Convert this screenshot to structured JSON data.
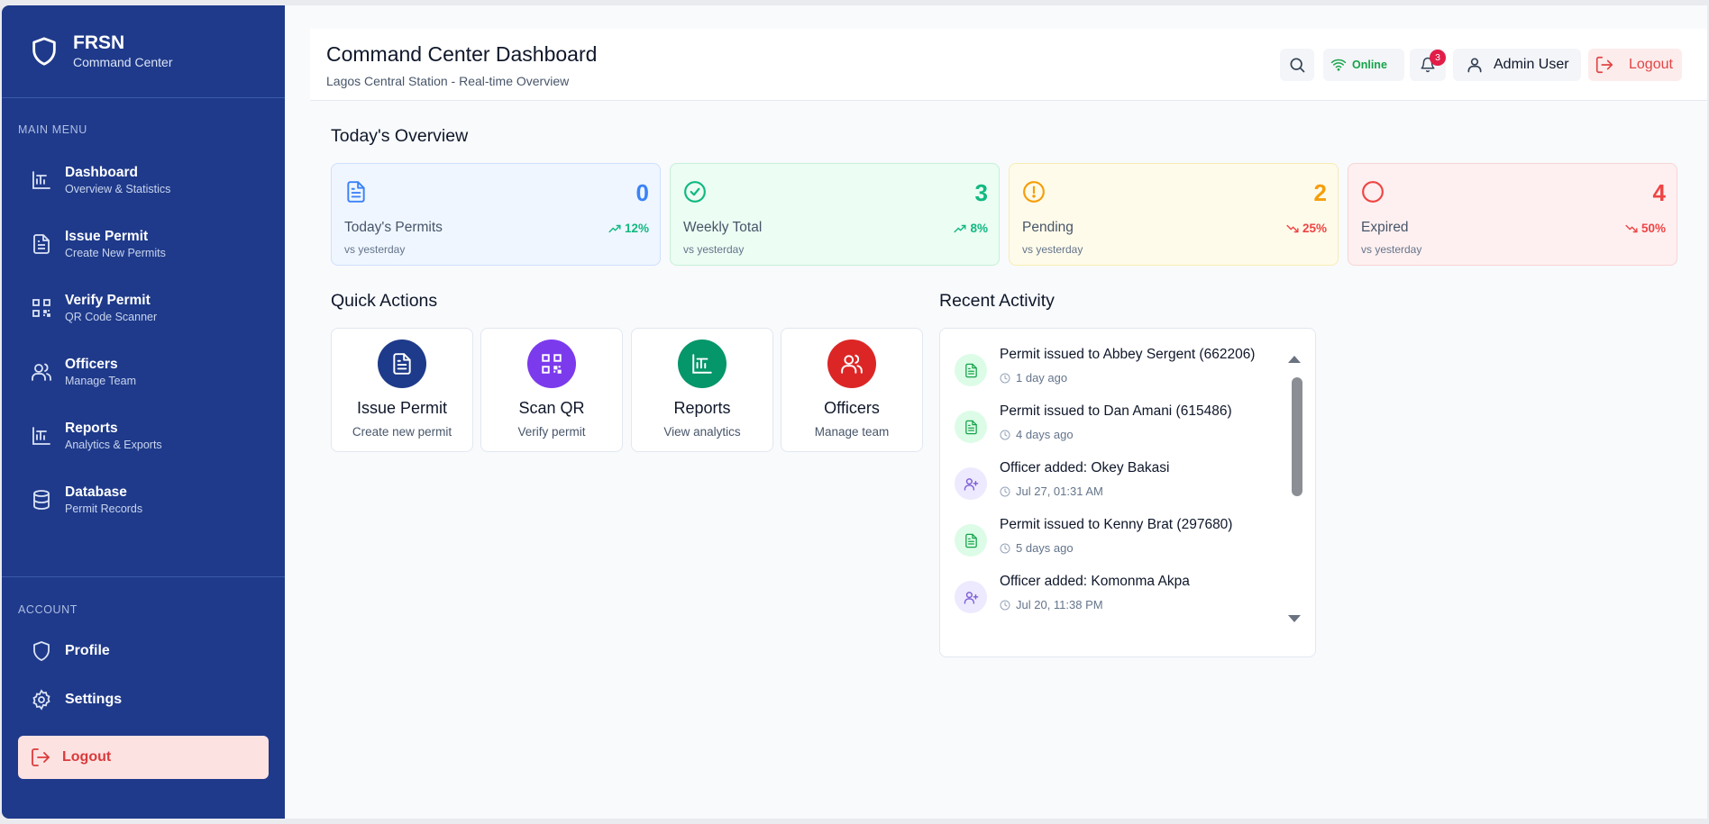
{
  "brand": {
    "name": "FRSN",
    "subtitle": "Command Center",
    "icon": "shield-icon"
  },
  "sidebar": {
    "main_menu_label": "MAIN MENU",
    "items": [
      {
        "title": "Dashboard",
        "subtitle": "Overview & Statistics",
        "icon": "bar-chart-icon"
      },
      {
        "title": "Issue Permit",
        "subtitle": "Create New Permits",
        "icon": "file-text-icon"
      },
      {
        "title": "Verify Permit",
        "subtitle": "QR Code Scanner",
        "icon": "qr-code-icon"
      },
      {
        "title": "Officers",
        "subtitle": "Manage Team",
        "icon": "users-icon"
      },
      {
        "title": "Reports",
        "subtitle": "Analytics & Exports",
        "icon": "bar-chart-icon"
      },
      {
        "title": "Database",
        "subtitle": "Permit Records",
        "icon": "database-icon"
      }
    ],
    "account_label": "ACCOUNT",
    "account_items": [
      {
        "title": "Profile",
        "icon": "shield-icon"
      },
      {
        "title": "Settings",
        "icon": "gear-icon"
      }
    ],
    "logout_label": "Logout"
  },
  "header": {
    "title": "Command Center Dashboard",
    "subtitle": "Lagos Central Station - Real-time Overview",
    "status": "Online",
    "notification_count": "3",
    "user_name": "Admin User",
    "logout_label": "Logout"
  },
  "overview": {
    "title": "Today's Overview",
    "cards": [
      {
        "label": "Today's Permits",
        "value": "0",
        "trend": "12%",
        "trend_dir": "up",
        "foot": "vs yesterday",
        "icon": "file-text-icon",
        "color": "#3b82f6",
        "bg": "#eff6ff",
        "border": "#cfe0fb",
        "trend_color": "#10b981"
      },
      {
        "label": "Weekly Total",
        "value": "3",
        "trend": "8%",
        "trend_dir": "up",
        "foot": "vs yesterday",
        "icon": "check-circle-icon",
        "color": "#10b981",
        "bg": "#ecfdf3",
        "border": "#c6f0d8",
        "trend_color": "#10b981"
      },
      {
        "label": "Pending",
        "value": "2",
        "trend": "25%",
        "trend_dir": "down",
        "foot": "vs yesterday",
        "icon": "alert-circle-icon",
        "color": "#f59e0b",
        "bg": "#fefbea",
        "border": "#f8ecb4",
        "trend_color": "#ef4444"
      },
      {
        "label": "Expired",
        "value": "4",
        "trend": "50%",
        "trend_dir": "down",
        "foot": "vs yesterday",
        "icon": "circle-icon",
        "color": "#ef4444",
        "bg": "#fef0f0",
        "border": "#f8d4d4",
        "trend_color": "#ef4444"
      }
    ]
  },
  "quick_actions": {
    "title": "Quick Actions",
    "items": [
      {
        "title": "Issue Permit",
        "subtitle": "Create new permit",
        "icon": "file-text-icon",
        "color": "#1e3a8a"
      },
      {
        "title": "Scan QR",
        "subtitle": "Verify permit",
        "icon": "qr-code-icon",
        "color": "#7c3aed"
      },
      {
        "title": "Reports",
        "subtitle": "View analytics",
        "icon": "bar-chart-icon",
        "color": "#059669"
      },
      {
        "title": "Officers",
        "subtitle": "Manage team",
        "icon": "users-icon",
        "color": "#dc2626"
      }
    ]
  },
  "activity": {
    "title": "Recent Activity",
    "items": [
      {
        "text": "Permit issued to Abbey Sergent (662206)",
        "time": "1 day ago",
        "kind": "permit"
      },
      {
        "text": "Permit issued to Dan Amani (615486)",
        "time": "4 days ago",
        "kind": "permit"
      },
      {
        "text": "Officer added: Okey Bakasi",
        "time": "Jul 27, 01:31 AM",
        "kind": "officer"
      },
      {
        "text": "Permit issued to Kenny Brat (297680)",
        "time": "5 days ago",
        "kind": "permit"
      },
      {
        "text": "Officer added: Komonma Akpa",
        "time": "Jul 20, 11:38 PM",
        "kind": "officer"
      }
    ]
  }
}
